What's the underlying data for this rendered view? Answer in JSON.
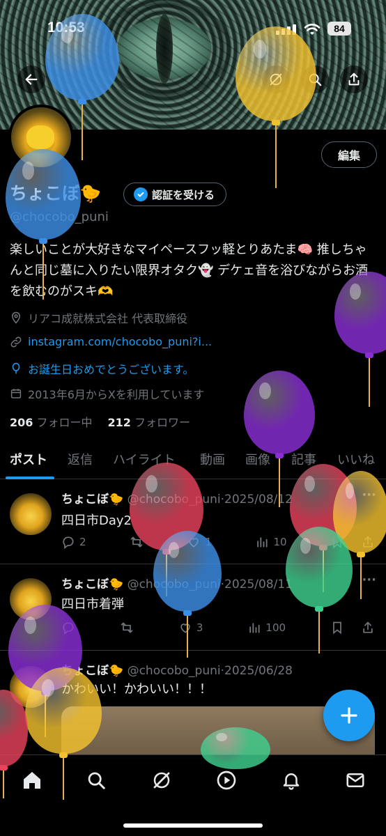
{
  "status_bar": {
    "time": "10:53",
    "battery": "84"
  },
  "profile": {
    "display_name": "ちょこぼ🐤",
    "verify_label": "認証を受ける",
    "handle": "@chocobo_puni",
    "edit_label": "編集",
    "bio": "楽しいことが大好きなマイペースフッ軽とりあたま🧠 推しちゃんと同じ墓に入りたい限界オタク👻 デケェ音を浴びながらお酒を飲むのがスキ🫶",
    "location": "リアコ成就株式会社 代表取締役",
    "link": "instagram.com/chocobo_puni?i...",
    "birthday": "お誕生日おめでとうございます。",
    "joined": "2013年6月からXを利用しています",
    "following_count": "206",
    "following_label": "フォロー中",
    "followers_count": "212",
    "followers_label": "フォロワー"
  },
  "tabs": [
    "ポスト",
    "返信",
    "ハイライト",
    "動画",
    "画像",
    "記事",
    "いいね"
  ],
  "posts": [
    {
      "name": "ちょこぼ🐤",
      "handle": "@chocobo_puni",
      "date": "·2025/08/12",
      "text": "四日市Day2",
      "replies": "2",
      "reposts": "",
      "likes": "1",
      "views": "10"
    },
    {
      "name": "ちょこぼ🐤",
      "handle": "@chocobo_puni",
      "date": "·2025/08/11",
      "text": "四日市着弾",
      "replies": "",
      "reposts": "",
      "likes": "3",
      "views": "100"
    },
    {
      "name": "ちょこぼ🐤",
      "handle": "@chocobo_puni",
      "date": "·2025/06/28",
      "text": "かわいい！かわいい！！！"
    }
  ],
  "balloon_colors": {
    "blue": "#3d8fe6",
    "yellow": "#f2c12e",
    "purple": "#8a2fd6",
    "red": "#e8425c",
    "green": "#3fcf8e"
  },
  "icons": {
    "back": "arrow-left-icon",
    "grok": "grok-icon",
    "search": "search-icon",
    "share": "share-icon",
    "home": "home-icon",
    "notifications": "bell-icon",
    "messages": "mail-icon",
    "compose": "plus-icon"
  },
  "accent_color": "#1d9bf0"
}
